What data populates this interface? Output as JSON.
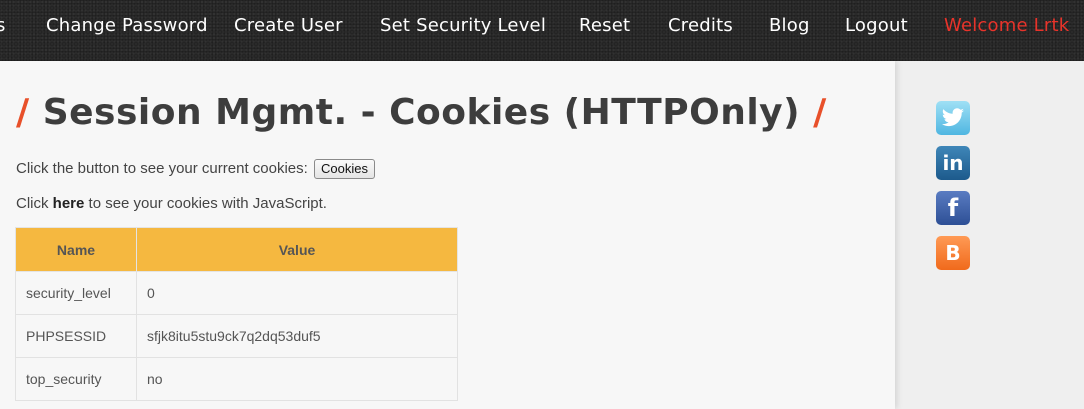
{
  "nav": {
    "items": [
      {
        "label": "s"
      },
      {
        "label": "Change Password"
      },
      {
        "label": "Create User"
      },
      {
        "label": "Set Security Level"
      },
      {
        "label": "Reset"
      },
      {
        "label": "Credits"
      },
      {
        "label": "Blog"
      },
      {
        "label": "Logout"
      }
    ],
    "welcome": "Welcome Lrtk"
  },
  "page": {
    "title_slash_left": "/",
    "title": "Session Mgmt. - Cookies (HTTPOnly)",
    "title_slash_right": "/",
    "line1_text": "Click the button to see your current cookies:",
    "cookies_button": "Cookies",
    "line2_prefix": "Click",
    "line2_link": "here",
    "line2_suffix": "to see your cookies with JavaScript."
  },
  "table": {
    "headers": [
      "Name",
      "Value"
    ],
    "rows": [
      {
        "name": "security_level",
        "value": "0"
      },
      {
        "name": "PHPSESSID",
        "value": "sfjk8itu5stu9ck7q2dq53duf5"
      },
      {
        "name": "top_security",
        "value": "no"
      }
    ]
  },
  "social": [
    {
      "icon": "twitter-icon",
      "glyph": "t"
    },
    {
      "icon": "linkedin-icon",
      "glyph": "in"
    },
    {
      "icon": "facebook-icon",
      "glyph": "f"
    },
    {
      "icon": "blogger-icon",
      "glyph": "B"
    }
  ],
  "colors": {
    "accent": "#e8502a",
    "welcome": "#e8332a",
    "table_header": "#f5b840"
  }
}
